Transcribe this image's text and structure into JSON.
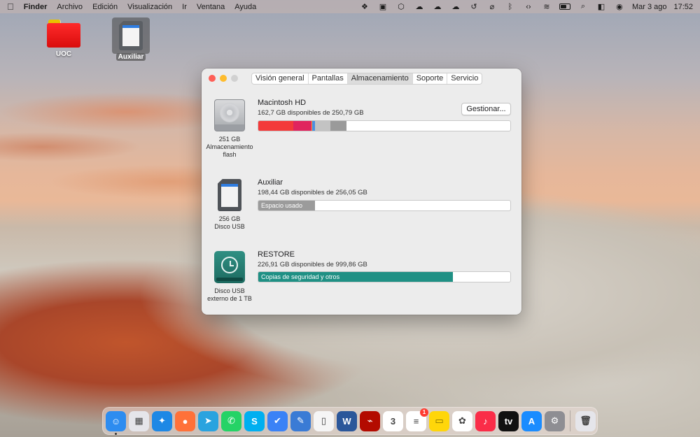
{
  "menubar": {
    "app_name": "Finder",
    "menus": [
      "Archivo",
      "Edición",
      "Visualización",
      "Ir",
      "Ventana",
      "Ayuda"
    ],
    "status_icons": [
      "dropbox-icon",
      "display-icon",
      "shield-icon",
      "cloud-upload-icon",
      "cloud-upload-icon",
      "cloud-icon",
      "time-machine-icon",
      "network-off-icon",
      "bluetooth-icon",
      "code-icon",
      "wifi-icon",
      "battery-icon",
      "search-icon",
      "control-center-icon",
      "siri-icon"
    ],
    "date": "Mar 3 ago",
    "time": "17:52"
  },
  "desktop": {
    "items": [
      {
        "label": "UOC",
        "icon": "red-folder-icon"
      },
      {
        "label": "Auxiliar",
        "icon": "sd-card-icon"
      }
    ]
  },
  "window": {
    "tabs": [
      "Visión general",
      "Pantallas",
      "Almacenamiento",
      "Soporte",
      "Servicio"
    ],
    "active_tab": "Almacenamiento",
    "drives": [
      {
        "name": "Macintosh HD",
        "available": "162,7 GB disponibles de 250,79 GB",
        "caption": [
          "251 GB",
          "Almacenamiento",
          "flash"
        ],
        "button": "Gestionar...",
        "segments": [
          {
            "color": "#f33a3a",
            "fraction": 0.14
          },
          {
            "color": "#e0245e",
            "fraction": 0.07
          },
          {
            "color": "#f5a13a",
            "fraction": 0.005
          },
          {
            "color": "#4a90e2",
            "fraction": 0.01
          },
          {
            "color": "#c3c3c3",
            "fraction": 0.06
          },
          {
            "color": "#9a9a9a",
            "fraction": 0.065
          }
        ]
      },
      {
        "name": "Auxiliar",
        "available": "198,44 GB disponibles de 256,05 GB",
        "caption": [
          "256 GB",
          "Disco USB"
        ],
        "bar_label": "Espacio usado",
        "segments": [
          {
            "color": "#9b9b9b",
            "fraction": 0.225
          }
        ]
      },
      {
        "name": "RESTORE",
        "available": "226,91 GB disponibles de 999,86 GB",
        "caption": [
          "Disco USB",
          "externo de 1 TB"
        ],
        "bar_label": "Copias de seguridad y otros",
        "segments": [
          {
            "color": "#1f9084",
            "fraction": 0.773
          }
        ]
      }
    ]
  },
  "dock": {
    "apps": [
      {
        "name": "finder-icon",
        "color": "#2d8cf0",
        "glyph": "☺"
      },
      {
        "name": "launchpad-icon",
        "color": "#e5e5ea",
        "glyph": "▦"
      },
      {
        "name": "safari-icon",
        "color": "#1e88e5",
        "glyph": "✦"
      },
      {
        "name": "firefox-icon",
        "color": "#ff7139",
        "glyph": "●"
      },
      {
        "name": "telegram-icon",
        "color": "#2aa3df",
        "glyph": "➤"
      },
      {
        "name": "whatsapp-icon",
        "color": "#25d366",
        "glyph": "✆"
      },
      {
        "name": "skype-icon",
        "color": "#00aff0",
        "glyph": "S"
      },
      {
        "name": "todo-icon",
        "color": "#3b82f6",
        "glyph": "✔"
      },
      {
        "name": "pencil-app-icon",
        "color": "#3a7bd5",
        "glyph": "✎"
      },
      {
        "name": "document-app-icon",
        "color": "#f5f5f5",
        "glyph": "▯"
      },
      {
        "name": "word-icon",
        "color": "#2b579a",
        "glyph": "W"
      },
      {
        "name": "acrobat-icon",
        "color": "#b30b00",
        "glyph": "⌁"
      },
      {
        "name": "calendar-icon",
        "color": "#ffffff",
        "glyph": "3"
      },
      {
        "name": "reminders-icon",
        "color": "#ffffff",
        "glyph": "≡",
        "badge": "1"
      },
      {
        "name": "notes-icon",
        "color": "#ffd60a",
        "glyph": "▭"
      },
      {
        "name": "photos-icon",
        "color": "#ffffff",
        "glyph": "✿"
      },
      {
        "name": "music-icon",
        "color": "#fa2d48",
        "glyph": "♪"
      },
      {
        "name": "apple-tv-icon",
        "color": "#111111",
        "glyph": "tv"
      },
      {
        "name": "app-store-icon",
        "color": "#1a8cff",
        "glyph": "A"
      },
      {
        "name": "system-preferences-icon",
        "color": "#8e8e93",
        "glyph": "⚙"
      }
    ],
    "trash": {
      "name": "trash-icon",
      "color": "#e5e5ea",
      "glyph": "🗑"
    }
  }
}
